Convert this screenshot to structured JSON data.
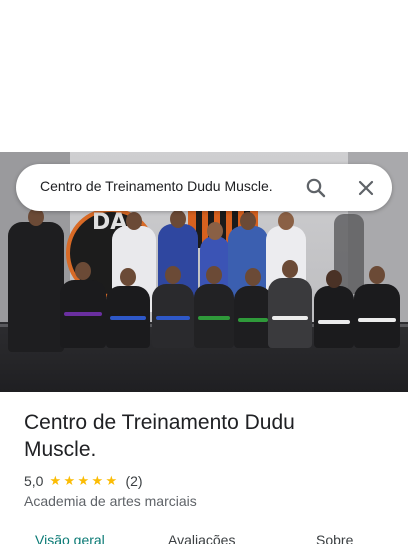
{
  "search": {
    "query": "Centro de Treinamento Dudu Muscle.",
    "search_icon": "search-icon",
    "close_icon": "close-icon"
  },
  "hero": {
    "image": "group photo of martial arts students in gi uniforms at the gym",
    "logo_text": "DA"
  },
  "place": {
    "title": "Centro de Treinamento Dudu Muscle.",
    "rating": "5,0",
    "stars": 5,
    "review_count": "(2)",
    "category": "Academia de artes marciais"
  },
  "tabs": [
    {
      "label": "Visão geral",
      "active": true
    },
    {
      "label": "Avaliações",
      "active": false
    },
    {
      "label": "Sobre",
      "active": false
    }
  ],
  "colors": {
    "accent": "#0b7a75",
    "star": "#fbbc04",
    "logo_ring": "#d86a26"
  }
}
